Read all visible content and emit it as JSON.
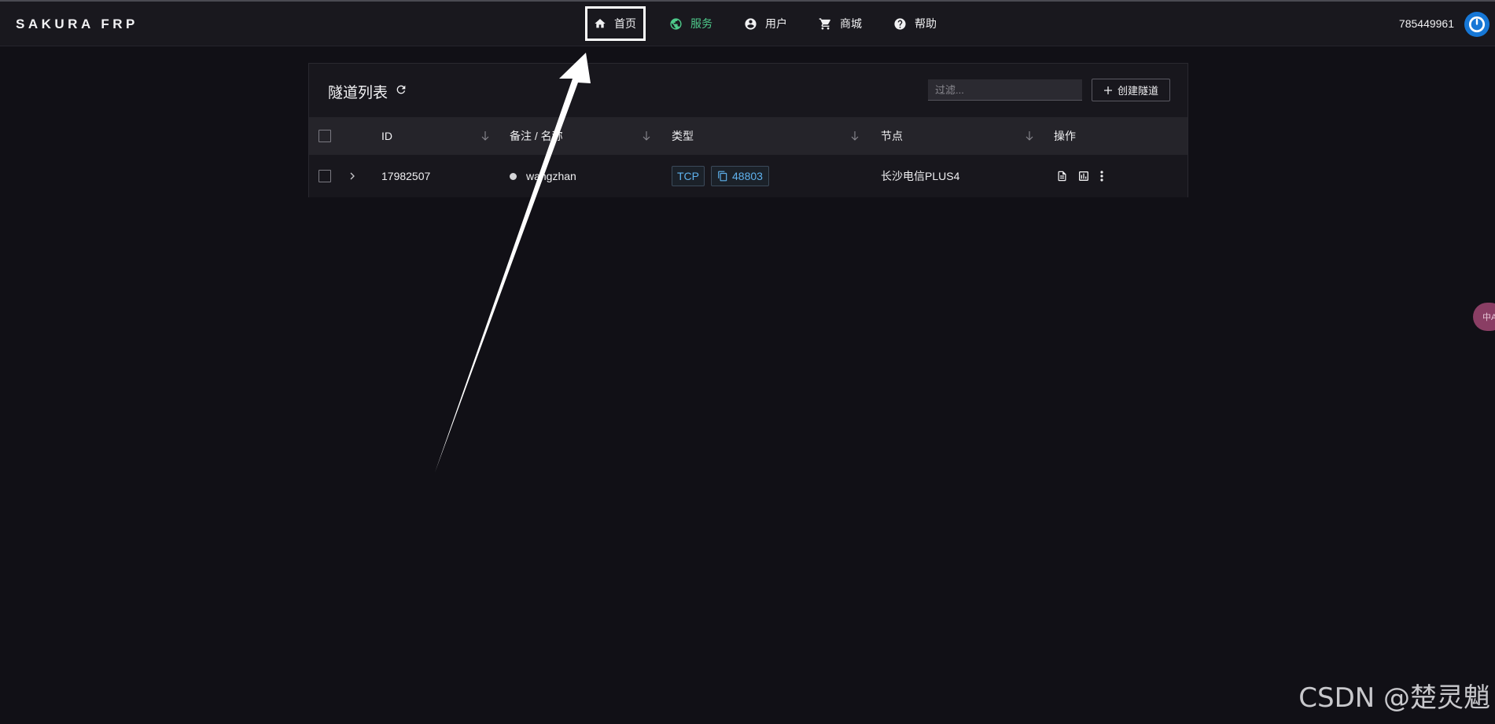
{
  "app": {
    "brand": "SAKURA FRP"
  },
  "nav": {
    "items": [
      {
        "label": "首页",
        "icon": "home-icon",
        "active": false,
        "highlighted": true
      },
      {
        "label": "服务",
        "icon": "globe-icon",
        "active": true,
        "highlighted": false
      },
      {
        "label": "用户",
        "icon": "user-circle-icon",
        "active": false,
        "highlighted": false
      },
      {
        "label": "商城",
        "icon": "cart-icon",
        "active": false,
        "highlighted": false
      },
      {
        "label": "帮助",
        "icon": "help-icon",
        "active": false,
        "highlighted": false
      }
    ]
  },
  "header": {
    "user_id": "785449961",
    "power_icon": "power-icon"
  },
  "tunnels": {
    "title": "隧道列表",
    "filter_placeholder": "过滤...",
    "create_label": "创建隧道",
    "columns": {
      "id": "ID",
      "name": "备注 / 名称",
      "type": "类型",
      "node": "节点",
      "actions": "操作"
    },
    "rows": [
      {
        "id": "17982507",
        "name": "wangzhan",
        "status_color": "#d5d5d8",
        "type": "TCP",
        "port": "48803",
        "node": "长沙电信PLUS4"
      }
    ]
  },
  "overlay": {
    "side_pill_text": "中A",
    "watermark": "CSDN @楚灵魈"
  },
  "colors": {
    "background": "#111016",
    "accent_green": "#4ec98a",
    "tag_blue": "#5fb2ee",
    "power_blue": "#1677d6"
  }
}
